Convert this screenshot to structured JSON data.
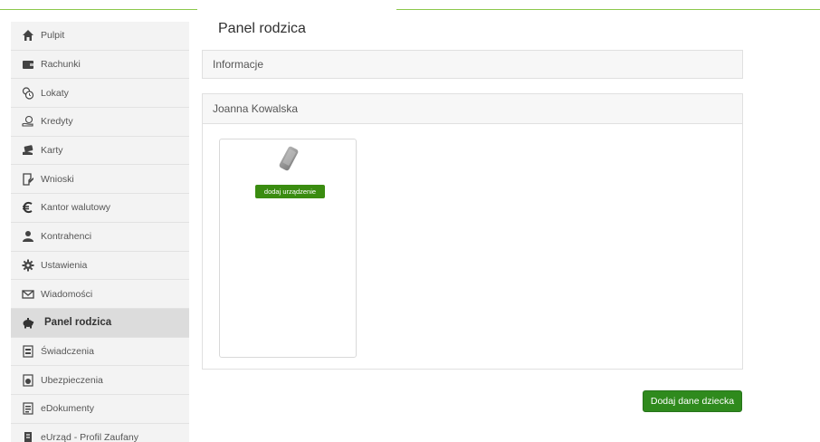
{
  "sidebar": {
    "items": [
      {
        "label": "Pulpit",
        "icon": "home-icon",
        "active": false
      },
      {
        "label": "Rachunki",
        "icon": "wallet-icon",
        "active": false
      },
      {
        "label": "Lokaty",
        "icon": "deposit-clock-icon",
        "active": false
      },
      {
        "label": "Kredyty",
        "icon": "loan-hand-icon",
        "active": false
      },
      {
        "label": "Karty",
        "icon": "card-hand-icon",
        "active": false
      },
      {
        "label": "Wnioski",
        "icon": "application-form-icon",
        "active": false
      },
      {
        "label": "Kantor walutowy",
        "icon": "euro-icon",
        "active": false
      },
      {
        "label": "Kontrahenci",
        "icon": "contractor-person-icon",
        "active": false
      },
      {
        "label": "Ustawienia",
        "icon": "gear-icon",
        "active": false
      },
      {
        "label": "Wiadomości",
        "icon": "envelope-icon",
        "active": false
      },
      {
        "label": "Panel rodzica",
        "icon": "piggy-bank-icon",
        "active": true
      },
      {
        "label": "Świadczenia",
        "icon": "document-stack-icon",
        "active": false
      },
      {
        "label": "Ubezpieczenia",
        "icon": "insurance-document-icon",
        "active": false
      },
      {
        "label": "eDokumenty",
        "icon": "edocument-icon",
        "active": false
      },
      {
        "label": "eUrząd - Profil Zaufany",
        "icon": "eurzad-icon",
        "active": false
      }
    ]
  },
  "main": {
    "title": "Panel rodzica",
    "info_panel": {
      "heading": "Informacje"
    },
    "child_panel": {
      "heading": "Joanna Kowalska",
      "device_card": {
        "icon": "phone-device-icon",
        "button_label": "dodaj urządzenie"
      }
    },
    "add_child_button": "Dodaj dane dziecka"
  },
  "colors": {
    "accent_green": "#2f8a1d",
    "sidebar_bg": "#f3f3f3",
    "sidebar_active_bg": "#dcdcdc",
    "top_line": "#8cc84b"
  }
}
